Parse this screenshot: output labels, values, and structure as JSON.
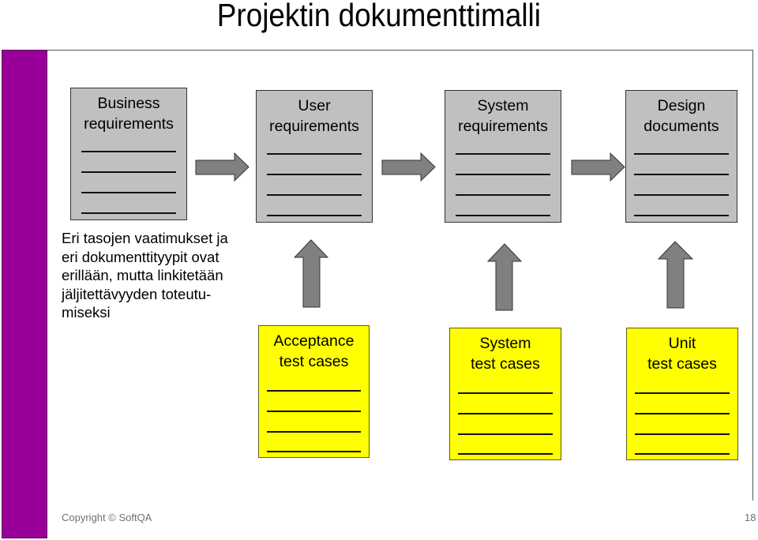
{
  "title": "Projektin dokumenttimalli",
  "colors": {
    "accent_bar": "#990099",
    "requirement_box": "#c0c0c0",
    "test_box": "#ffff00",
    "arrow": "#808080"
  },
  "requirement_documents": [
    {
      "label": "Business\nrequirements",
      "lines": 4
    },
    {
      "label": "User\nrequirements",
      "lines": 4
    },
    {
      "label": "System\nrequirements",
      "lines": 4
    },
    {
      "label": "Design\ndocuments",
      "lines": 4
    }
  ],
  "test_documents": [
    {
      "label": "Acceptance\ntest cases",
      "traces_to": "User requirements",
      "lines": 4
    },
    {
      "label": "System\ntest cases",
      "traces_to": "System requirements",
      "lines": 4
    },
    {
      "label": "Unit\ntest cases",
      "traces_to": "Design documents",
      "lines": 4
    }
  ],
  "flow_arrows": [
    {
      "from": "Business requirements",
      "to": "User requirements",
      "direction": "right"
    },
    {
      "from": "User requirements",
      "to": "System requirements",
      "direction": "right"
    },
    {
      "from": "System requirements",
      "to": "Design documents",
      "direction": "right"
    },
    {
      "from": "Acceptance test cases",
      "to": "User requirements",
      "direction": "up"
    },
    {
      "from": "System test cases",
      "to": "System requirements",
      "direction": "up"
    },
    {
      "from": "Unit test cases",
      "to": "Design documents",
      "direction": "up"
    }
  ],
  "note": "Eri tasojen vaatimukset ja\neri dokumenttityypit ovat\nerillään, mutta linkitetään\njäljitettävyyden toteutu-\nmiseksi",
  "footer": {
    "copyright": "Copyright © SoftQA",
    "page_number": "18"
  }
}
